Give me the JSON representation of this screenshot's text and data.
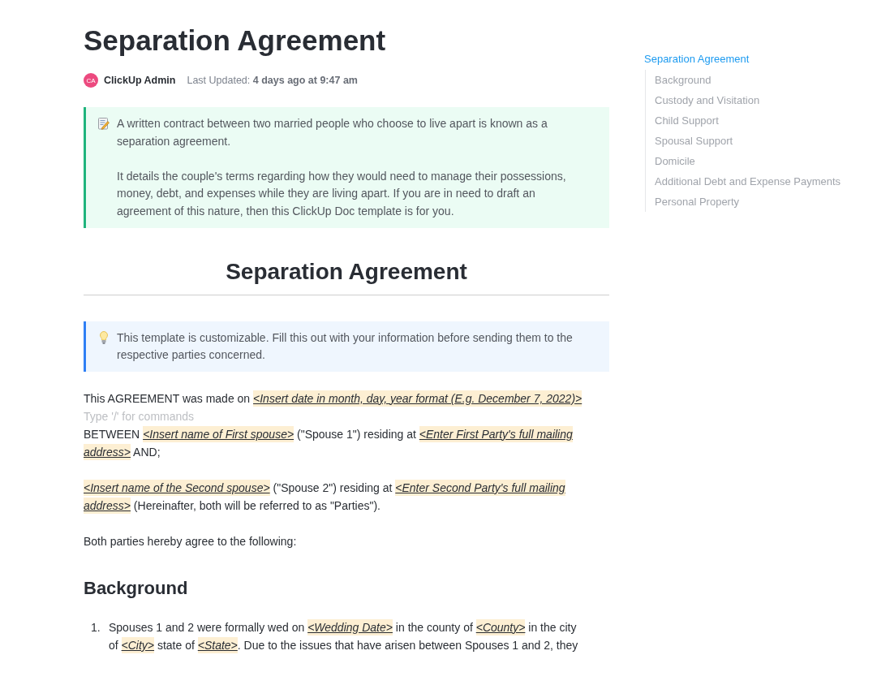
{
  "page": {
    "title": "Separation Agreement",
    "author": {
      "initials": "CA",
      "name": "ClickUp Admin"
    },
    "last_updated": "Last Updated: **4 days ago at 9:47 am**"
  },
  "blocks": [
    {
      "kind": "note_callout",
      "paragraphs": [
        "A written contract between two married people who choose to live apart is known as a separation agreement.",
        "It details the couple's terms regarding how they would need to manage their possessions, money, debt, and expenses while they are living apart. If you are in need to draft an agreement of this nature, then this ClickUp Doc template is for you."
      ]
    },
    {
      "kind": "title_heading",
      "text": "Separation Agreement"
    },
    {
      "kind": "tip_callout",
      "paragraphs": [
        "This template is customizable. Fill this out with your information before sending them to the respective parties concerned."
      ]
    },
    {
      "kind": "paragraph",
      "segments": [
        {
          "kind": "text",
          "text": "This AGREEMENT was made on "
        },
        {
          "kind": "placeholder",
          "text": "<Insert date in month, day, year format (E.g. December 7, 2022)>"
        }
      ]
    },
    {
      "kind": "hint",
      "placeholder": "Type '/' for commands"
    },
    {
      "kind": "paragraph",
      "segments": [
        {
          "kind": "text",
          "text": "BETWEEN "
        },
        {
          "kind": "placeholder",
          "text": "<Insert name of First spouse>"
        },
        {
          "kind": "text",
          "text": " (\"Spouse 1\") residing at "
        },
        {
          "kind": "placeholder",
          "text": "<Enter First Party's full mailing address>"
        },
        {
          "kind": "text",
          "text": " AND;"
        }
      ]
    },
    {
      "kind": "paragraph",
      "segments": [
        {
          "kind": "placeholder",
          "text": "<Insert name of the Second spouse>"
        },
        {
          "kind": "text",
          "text": " (\"Spouse 2\") residing at "
        },
        {
          "kind": "placeholder",
          "text": "<Enter Second Party's full mailing address>"
        },
        {
          "kind": "text",
          "text": "  (Hereinafter, both will be referred to as \"Parties\")."
        }
      ]
    },
    {
      "kind": "paragraph",
      "segments": [
        {
          "kind": "text",
          "text": "Both parties hereby agree to the following:"
        }
      ]
    },
    {
      "kind": "heading",
      "text": "Background"
    },
    {
      "kind": "list",
      "items": [
        {
          "number": "1.",
          "segments": [
            {
              "kind": "text",
              "text": "Spouses 1 and 2 were formally wed on "
            },
            {
              "kind": "placeholder",
              "text": "<Wedding Date>"
            },
            {
              "kind": "text",
              "text": " in the county of "
            },
            {
              "kind": "placeholder",
              "text": "<County>"
            },
            {
              "kind": "text",
              "text": " in the city of "
            },
            {
              "kind": "placeholder",
              "text": "<City>"
            },
            {
              "kind": "text",
              "text": " state of "
            },
            {
              "kind": "placeholder",
              "text": "<State>"
            },
            {
              "kind": "text",
              "text": ". Due to the issues that have arisen between Spouses 1 and 2, they"
            }
          ]
        }
      ]
    }
  ],
  "outline": [
    {
      "label": "Separation Agreement",
      "selected": true,
      "children": [
        {
          "label": "Background",
          "selected": false
        },
        {
          "label": "Custody and Visitation",
          "selected": false
        },
        {
          "label": "Child Support",
          "selected": false
        },
        {
          "label": "Spousal Support",
          "selected": false
        },
        {
          "label": "Domicile",
          "selected": false
        },
        {
          "label": "Additional Debt and Expense Payments",
          "selected": false
        },
        {
          "label": "Personal Property",
          "selected": false
        }
      ]
    }
  ]
}
